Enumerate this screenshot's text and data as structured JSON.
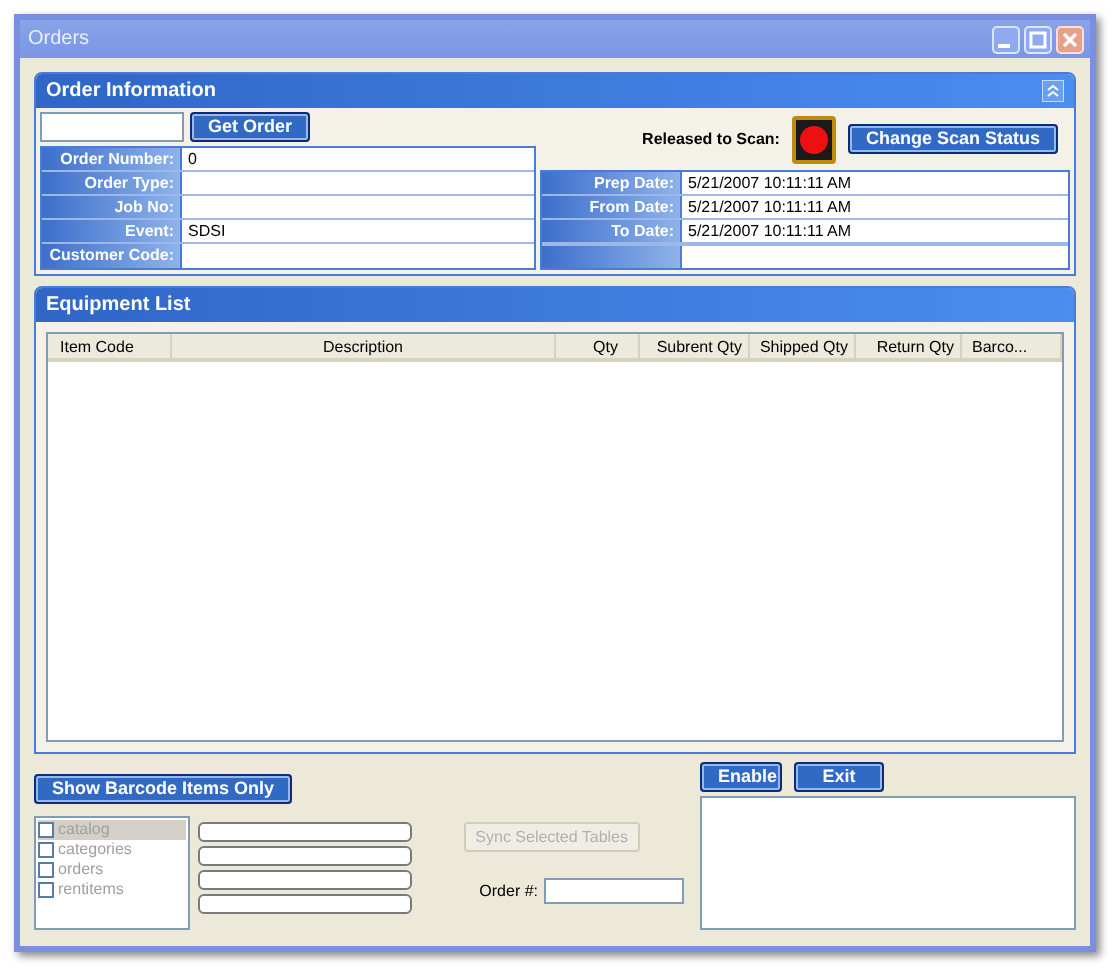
{
  "window": {
    "title": "Orders"
  },
  "order_information": {
    "title": "Order Information",
    "get_order_button": "Get Order",
    "fields": [
      {
        "label": "Order Number:",
        "value": "0"
      },
      {
        "label": "Order Type:"
      },
      {
        "label": "Job No:"
      },
      {
        "label": "Event:",
        "value": "SDSI"
      },
      {
        "label": "Customer Code:"
      }
    ],
    "released_label": "Released to Scan:",
    "released": false,
    "change_scan_button": "Change Scan Status",
    "dates": [
      {
        "label": "Prep Date:",
        "value": "5/21/2007 10:11:11 AM"
      },
      {
        "label": "From Date:",
        "value": "5/21/2007 10:11:11 AM"
      },
      {
        "label": "To Date:",
        "value": "5/21/2007 10:11:11 AM"
      }
    ]
  },
  "equipment_list": {
    "title": "Equipment List",
    "table": {
      "columns": [
        "Item Code",
        "Description",
        "Qty",
        "Subrent Qty",
        "Shipped Qty",
        "Return Qty",
        "Barco..."
      ]
    }
  },
  "show_barcode_button": "Show Barcode Items Only",
  "enable_button": "Enable",
  "exit_button": "Exit",
  "tables": [
    {
      "label": "catalog",
      "checked": false,
      "selected": true
    },
    {
      "label": "categories",
      "checked": false,
      "selected": false
    },
    {
      "label": "orders",
      "checked": false,
      "selected": false
    },
    {
      "label": "rentitems",
      "checked": false,
      "selected": false
    }
  ],
  "progress_bars": [
    {
      "level": 0
    },
    {
      "level": 0
    },
    {
      "level": 0
    },
    {
      "level": 0
    }
  ],
  "sync_button": {
    "label": "Sync Selected Tables",
    "disabled": true
  },
  "order_number": {
    "label": "Order #:"
  }
}
